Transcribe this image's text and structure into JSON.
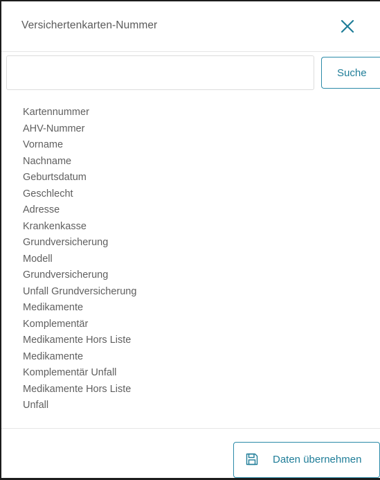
{
  "dialog": {
    "title": "Versichertenkarten-Nummer",
    "close_icon": "close-icon"
  },
  "search": {
    "value": "",
    "placeholder": "",
    "button_label": "Suche"
  },
  "fields": [
    "Kartennummer",
    "AHV-Nummer",
    "Vorname",
    "Nachname",
    "Geburtsdatum",
    "Geschlecht",
    "Adresse",
    "Krankenkasse",
    "Grundversicherung",
    "Modell",
    "Grundversicherung",
    "Unfall Grundversicherung",
    "Medikamente",
    "Komplementär",
    "Medikamente Hors Liste",
    "Medikamente",
    "Komplementär Unfall",
    "Medikamente Hors Liste",
    "Unfall"
  ],
  "footer": {
    "apply_label": "Daten übernehmen",
    "apply_icon": "save-icon"
  },
  "colors": {
    "accent": "#1f7d98",
    "text": "#5f5f5f",
    "border": "#dcdcdc"
  }
}
